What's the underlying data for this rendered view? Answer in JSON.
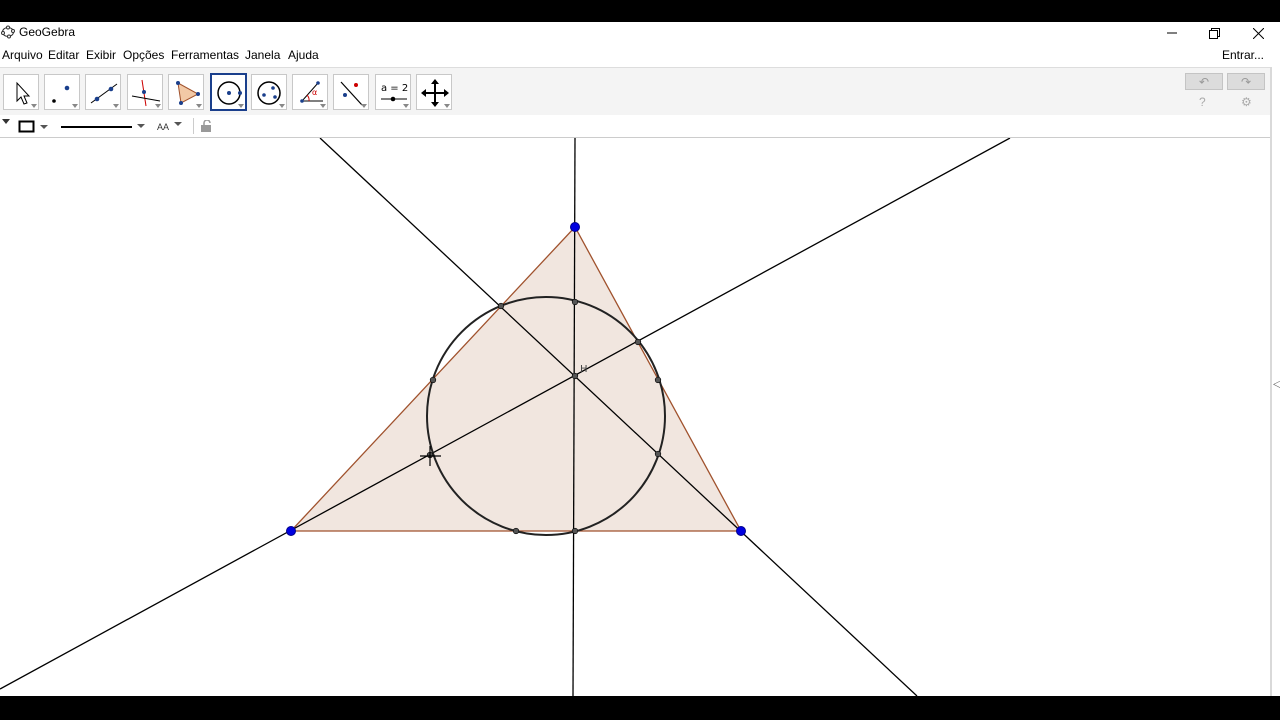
{
  "window": {
    "title": "GeoGebra"
  },
  "menu": {
    "items": [
      "Arquivo",
      "Editar",
      "Exibir",
      "Opções",
      "Ferramentas",
      "Janela",
      "Ajuda"
    ],
    "login_label": "Entrar..."
  },
  "toolbar": {
    "selected_tool": "circle-with-center-tool",
    "tools": [
      "move-tool",
      "point-tool",
      "line-tool",
      "perpendicular-line-tool",
      "polygon-tool",
      "circle-with-center-tool",
      "circle-through-points-tool",
      "angle-tool",
      "reflect-tool",
      "slider-tool",
      "move-graphics-view-tool"
    ],
    "slider_icon_text": "a = 2"
  },
  "stylebar": {
    "font_size_label": "AA"
  },
  "graphics": {
    "point_label": "H",
    "colors": {
      "triangle_fill": "#f1e6df",
      "triangle_edge": "#a0522d",
      "vertex": "#0000e0",
      "line": "#000000",
      "circle": "#222222"
    }
  }
}
